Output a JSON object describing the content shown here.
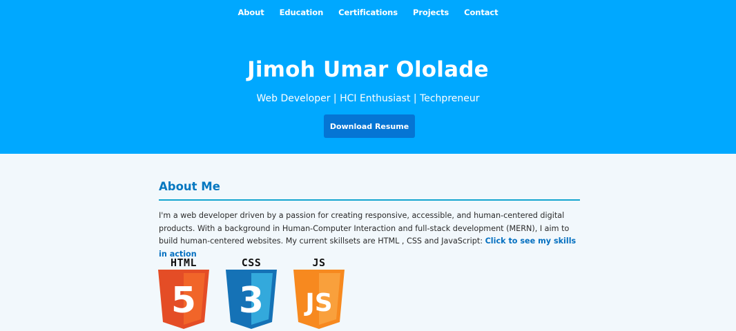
{
  "nav": {
    "items": [
      {
        "label": "About"
      },
      {
        "label": "Education"
      },
      {
        "label": "Certifications"
      },
      {
        "label": "Projects"
      },
      {
        "label": "Contact"
      }
    ]
  },
  "hero": {
    "name": "Jimoh Umar Ololade",
    "tagline": "Web Developer | HCI Enthusiast | Techpreneur",
    "button_label": "Download Resume"
  },
  "about": {
    "title": "About Me",
    "paragraph_start": "I'm a web developer driven by a passion for creating responsive, accessible, and human-centered digital products. With a background in Human-Computer Interaction and full-stack development (MERN), I aim to build human-centered websites. My current skillsets are HTML , CSS and JavaScript: ",
    "link_label": "Click to see my skills in action"
  },
  "skills": [
    {
      "label": "HTML",
      "icon": "html5-icon",
      "glyph": "5",
      "color": "#e44d26",
      "shade": "#f16529"
    },
    {
      "label": "CSS",
      "icon": "css3-icon",
      "glyph": "3",
      "color": "#1572b6",
      "shade": "#33a9dc"
    },
    {
      "label": "JS",
      "icon": "javascript-icon",
      "glyph": "JS",
      "color": "#f7891f",
      "shade": "#f9a03c"
    }
  ]
}
